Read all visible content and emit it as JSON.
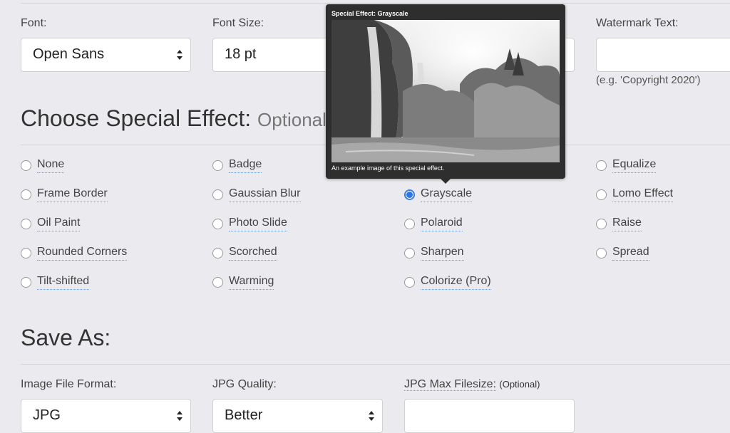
{
  "font_section": {
    "font_label": "Font:",
    "font_value": "Open Sans",
    "size_label": "Font Size:",
    "size_value": "18 pt",
    "watermark_label": "Watermark Text:",
    "watermark_value": "",
    "watermark_hint": "(e.g. 'Copyright 2020')"
  },
  "effects": {
    "heading": "Choose Special Effect:",
    "heading_optional": "Optional",
    "options": [
      "None",
      "Badge",
      "",
      "Equalize",
      "Frame Border",
      "Gaussian Blur",
      "Grayscale",
      "Lomo Effect",
      "Oil Paint",
      "Photo Slide",
      "Polaroid",
      "Raise",
      "Rounded Corners",
      "Scorched",
      "Sharpen",
      "Spread",
      "Tilt-shifted",
      "Warming",
      "Colorize (Pro)"
    ],
    "selected": "Grayscale"
  },
  "tooltip": {
    "title": "Special Effect: Grayscale",
    "caption": "An example image of this special effect."
  },
  "save_as": {
    "heading": "Save As:",
    "format_label": "Image File Format:",
    "format_value": "JPG",
    "quality_label": "JPG Quality:",
    "quality_value": "Better",
    "maxsize_label": "JPG Max Filesize:",
    "maxsize_optional": "(Optional)",
    "maxsize_value": ""
  },
  "colors": {
    "background": "#ebebef",
    "accent": "#2b78e4",
    "tooltip_bg": "#2e2e2e"
  }
}
